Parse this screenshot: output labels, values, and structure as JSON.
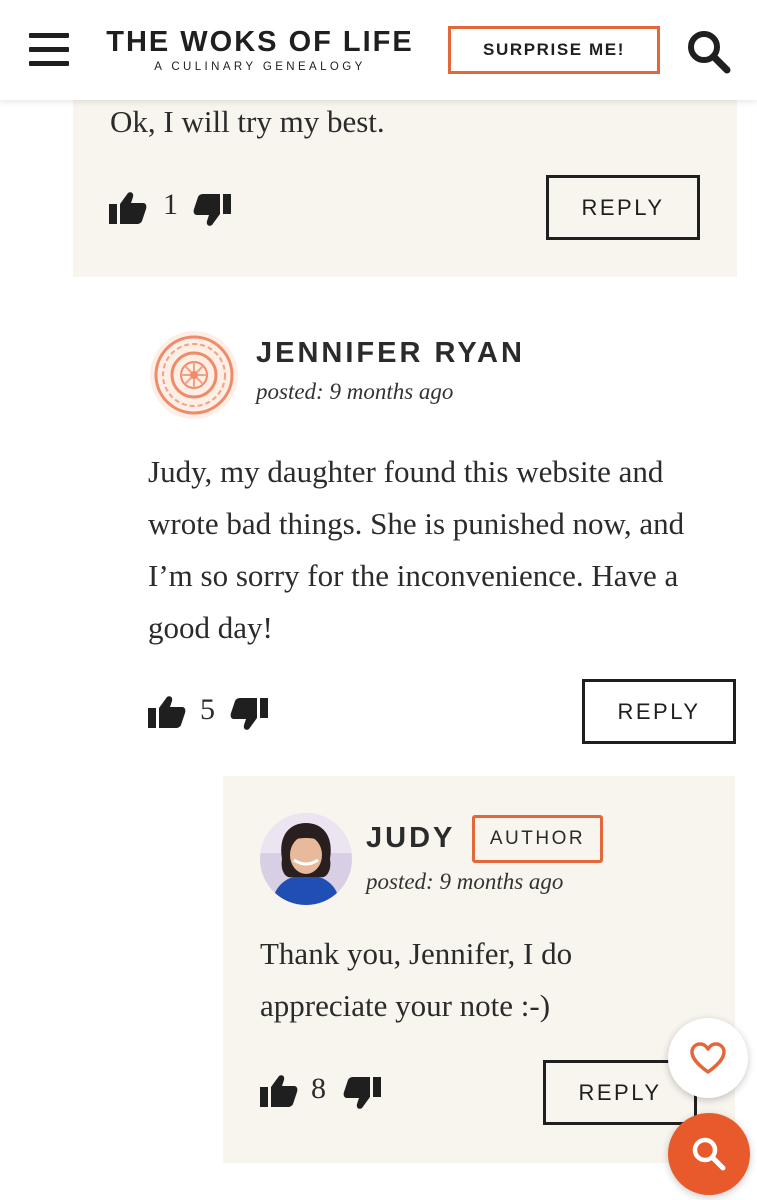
{
  "header": {
    "site_title": "THE WOKS OF LIFE",
    "tagline": "A CULINARY GENEALOGY",
    "surprise_label": "SURPRISE ME!",
    "accent_color": "#e2673a"
  },
  "comments": [
    {
      "text": "Ok, I will try my best.",
      "likes": "1",
      "reply_label": "REPLY"
    },
    {
      "author": "JENNIFER RYAN",
      "posted": "posted: 9 months ago",
      "text": "Judy, my daughter found this website and wrote bad things. She is punished now, and I’m so sorry for the inconvenience. Have a good day!",
      "likes": "5",
      "reply_label": "REPLY",
      "avatar": "default-flower-avatar"
    },
    {
      "author": "JUDY",
      "badge": "AUTHOR",
      "posted": "posted: 9 months ago",
      "text": "Thank you, Jennifer, I do appreciate your note :-)",
      "likes": "8",
      "reply_label": "REPLY",
      "avatar": "photo-avatar"
    }
  ],
  "floating": {
    "favorite_icon": "heart-icon",
    "search_icon": "search-icon",
    "search_color": "#e8592b"
  }
}
